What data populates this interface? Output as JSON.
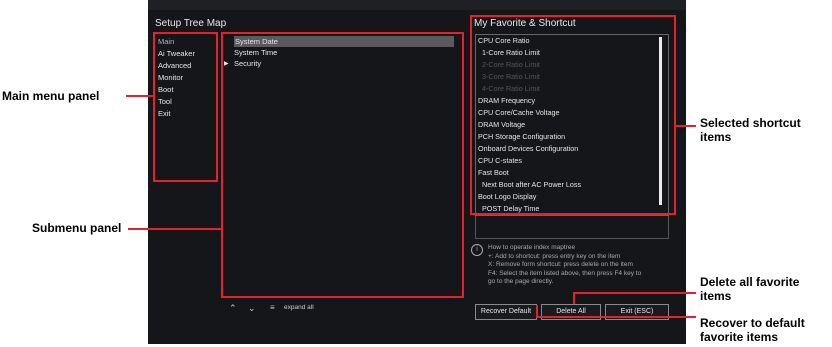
{
  "screen": {
    "title": "Setup Tree Map",
    "favorites_title": "My Favorite & Shortcut"
  },
  "main_menu": {
    "items": [
      "Main",
      "Ai Tweaker",
      "Advanced",
      "Monitor",
      "Boot",
      "Tool",
      "Exit"
    ]
  },
  "submenu": {
    "items": [
      "System Date",
      "System Time",
      "Security"
    ]
  },
  "favorites": {
    "items": [
      "CPU Core Ratio",
      "1-Core Ratio Limit",
      "2-Core Ratio Limit",
      "3-Core Ratio Limit",
      "4-Core Ratio Limit",
      "DRAM Frequency",
      "CPU Core/Cache Voltage",
      "DRAM Voltage",
      "PCH Storage Configuration",
      "Onboard Devices Configuration",
      "CPU C-states",
      "Fast Boot",
      "Next Boot after AC Power Loss",
      "Boot Logo Display",
      "POST Delay Time"
    ]
  },
  "info": {
    "lines": [
      "How to operate index maptree",
      "+: Add to shortcut: press entry key on the item",
      "X: Remove form shortcut: press delete on the item",
      "F4: Select the item listed above, then press F4 key to",
      "go to the page directly."
    ]
  },
  "buttons": {
    "recover": "Recover Default",
    "delete_all": "Delete All",
    "exit": "Exit (ESC)"
  },
  "bottom_bar": {
    "expand_label": "expand all"
  },
  "callouts": {
    "main_menu_panel": "Main menu panel",
    "submenu_panel": "Submenu panel",
    "selected_shortcut": "Selected shortcut items",
    "delete_all": "Delete all favorite items",
    "recover": "Recover to default favorite items"
  },
  "colors": {
    "accent_red": "#e8202a",
    "background": "#151619"
  }
}
